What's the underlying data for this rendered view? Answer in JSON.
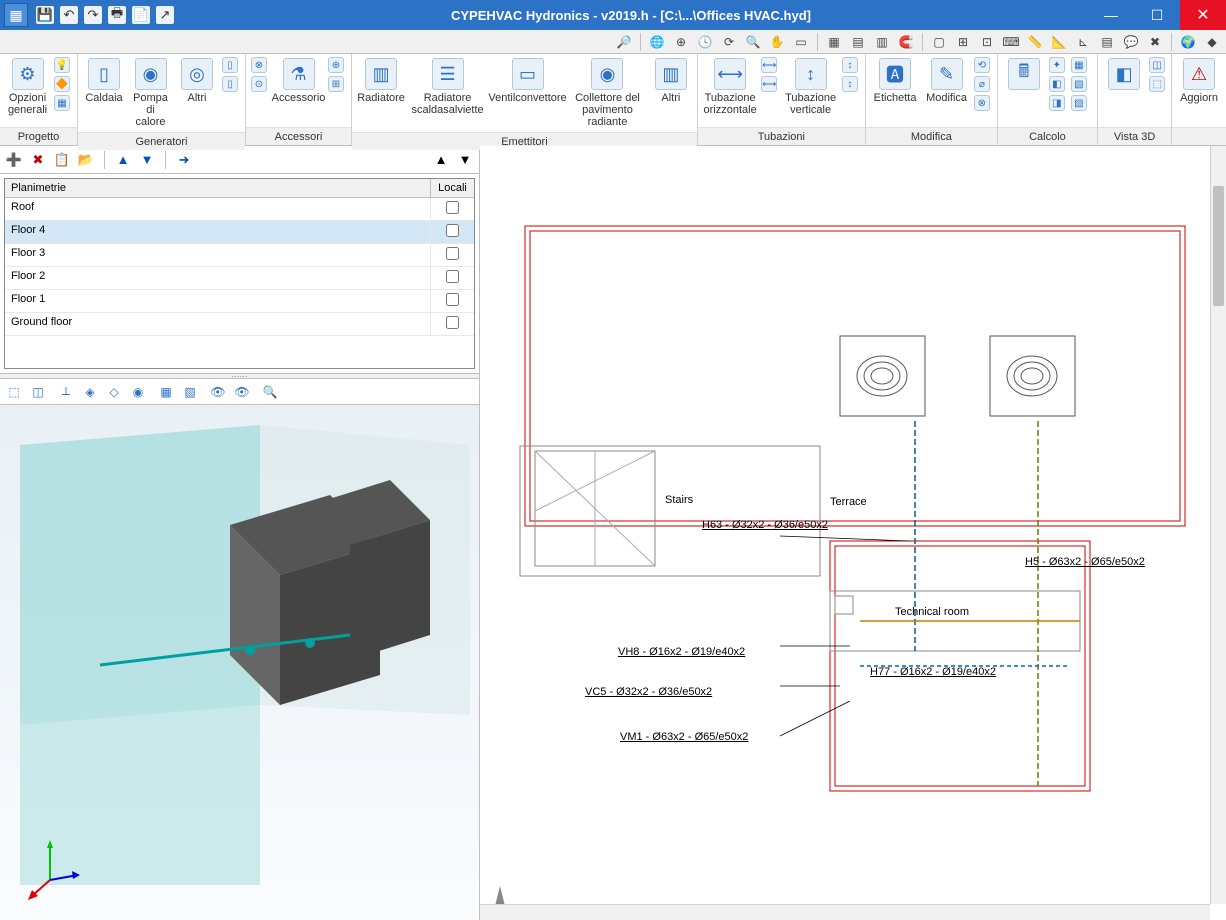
{
  "title": "CYPEHVAC Hydronics - v2019.h - [C:\\...\\Offices HVAC.hyd]",
  "ribbon_groups": {
    "progetto": "Progetto",
    "generatori": "Generatori",
    "accessori": "Accessori",
    "emettitori": "Emettitori",
    "tubazioni": "Tubazioni",
    "modifica": "Modifica",
    "calcolo": "Calcolo",
    "vista3d": "Vista 3D"
  },
  "ribbon_items": {
    "opzioni_generali": "Opzioni generali",
    "caldaia": "Caldaia",
    "pompa_di_calore": "Pompa di calore",
    "altri": "Altri",
    "accessorio": "Accessorio",
    "radiatore": "Radiatore",
    "radiatore_scalda": "Radiatore scaldasalviette",
    "ventilconvettore": "Ventilconvettore",
    "collettore": "Collettore del pavimento radiante",
    "altri2": "Altri",
    "tubazione_orizz": "Tubazione orizzontale",
    "tubazione_vert": "Tubazione verticale",
    "etichetta": "Etichetta",
    "modifica_btn": "Modifica",
    "aggiorna": "Aggiorn"
  },
  "plan_table": {
    "header_planimetrie": "Planimetrie",
    "header_locali": "Locali",
    "rows": [
      {
        "name": "Roof",
        "checked": false,
        "selected": false
      },
      {
        "name": "Floor 4",
        "checked": false,
        "selected": true
      },
      {
        "name": "Floor 3",
        "checked": false,
        "selected": false
      },
      {
        "name": "Floor 2",
        "checked": false,
        "selected": false
      },
      {
        "name": "Floor 1",
        "checked": false,
        "selected": false
      },
      {
        "name": "Ground floor",
        "checked": false,
        "selected": false
      }
    ]
  },
  "drawing_labels": {
    "stairs": "Stairs",
    "terrace": "Terrace",
    "technical_room": "Technical room",
    "h63": "H63 - Ø32x2 - Ø36/e50x2",
    "h5": "H5 - Ø63x2 - Ø65/e50x2",
    "h77": "H77 - Ø16x2 - Ø19/e40x2",
    "vh8": "VH8 - Ø16x2 - Ø19/e40x2",
    "vc5": "VC5 - Ø32x2 - Ø36/e50x2",
    "vm1": "VM1 - Ø63x2 - Ø65/e50x2"
  }
}
